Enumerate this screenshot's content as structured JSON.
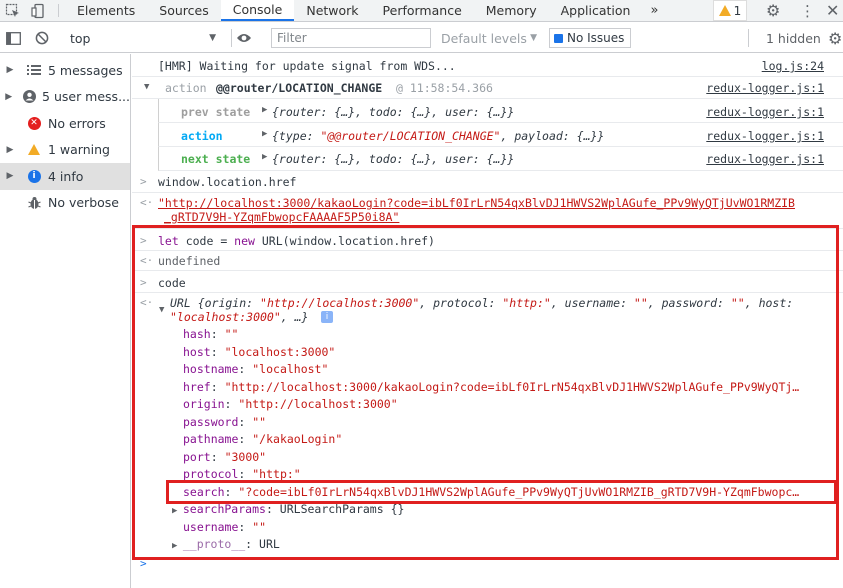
{
  "tabs": {
    "items": [
      "Elements",
      "Sources",
      "Console",
      "Network",
      "Performance",
      "Memory",
      "Application"
    ],
    "more": "»",
    "warning_count": "1"
  },
  "toolbar": {
    "context": "top",
    "filter_placeholder": "Filter",
    "levels": "Default levels",
    "issues": "No Issues",
    "hidden": "1 hidden"
  },
  "sidebar": {
    "items": [
      {
        "label": "5 messages",
        "icon": "list-icon"
      },
      {
        "label": "5 user mess...",
        "icon": "user-icon"
      },
      {
        "label": "No errors",
        "icon": "error-icon"
      },
      {
        "label": "1 warning",
        "icon": "warning-icon"
      },
      {
        "label": "4 info",
        "icon": "info-icon"
      },
      {
        "label": "No verbose",
        "icon": "bug-icon"
      }
    ]
  },
  "console": {
    "hmr": {
      "text": "[HMR] Waiting for update signal from WDS...",
      "source": "log.js:24"
    },
    "action_group": {
      "prefix": "action",
      "name": "@@router/LOCATION_CHANGE",
      "time": "@ 11:58:54.366",
      "source": "redux-logger.js:1"
    },
    "prev_state": {
      "label": "prev state",
      "value": "{router: {…}, todo: {…}, user: {…}}",
      "source": "redux-logger.js:1"
    },
    "action": {
      "label": "action",
      "value_pre": "{type: ",
      "value_str": "\"@@router/LOCATION_CHANGE\"",
      "value_post": ", payload: {…}}",
      "source": "redux-logger.js:1"
    },
    "next_state": {
      "label": "next state",
      "value": "{router: {…}, todo: {…}, user: {…}}",
      "source": "redux-logger.js:1"
    },
    "input1": "window.location.href",
    "result1_line1": "\"http://localhost:3000/kakaoLogin?code=ibLf0IrLrN54qxBlvDJ1HWVS2WplAGufe_PPv9WyQTjUvWO1RMZIB",
    "result1_line2": "_gRTD7V9H-YZqmFbwopcFAAAAF5P50i8A\"",
    "input2": {
      "kw1": "let",
      "var": " code = ",
      "kw2": "new",
      "rest": " URL(window.location.href)"
    },
    "result2": "undefined",
    "input3": "code",
    "url_obj": {
      "line1_pre": "URL {origin: ",
      "line1_origin": "\"http://localhost:3000\"",
      "line1_mid1": ", protocol: ",
      "line1_protocol": "\"http:\"",
      "line1_mid2": ", username: ",
      "line1_username": "\"\"",
      "line1_mid3": ", password: ",
      "line1_password": "\"\"",
      "line1_mid4": ", host: ",
      "line2_host": "\"localhost:3000\"",
      "line2_post": ", …}",
      "props": [
        {
          "key": "hash",
          "value": "\"\""
        },
        {
          "key": "host",
          "value": "\"localhost:3000\""
        },
        {
          "key": "hostname",
          "value": "\"localhost\""
        },
        {
          "key": "href",
          "value": "\"http://localhost:3000/kakaoLogin?code=ibLf0IrLrN54qxBlvDJ1HWVS2WplAGufe_PPv9WyQTj…"
        },
        {
          "key": "origin",
          "value": "\"http://localhost:3000\""
        },
        {
          "key": "password",
          "value": "\"\""
        },
        {
          "key": "pathname",
          "value": "\"/kakaoLogin\""
        },
        {
          "key": "port",
          "value": "\"3000\""
        },
        {
          "key": "protocol",
          "value": "\"http:\""
        },
        {
          "key": "search",
          "value": "\"?code=ibLf0IrLrN54qxBlvDJ1HWVS2WplAGufe_PPv9WyQTjUvWO1RMZIB_gRTD7V9H-YZqmFbwopc…"
        },
        {
          "key": "searchParams",
          "value": "URLSearchParams {}"
        },
        {
          "key": "username",
          "value": "\"\""
        },
        {
          "key": "__proto__",
          "value": "URL"
        }
      ]
    }
  },
  "colors": {
    "highlight": "#e02020",
    "accent": "#1a73e8",
    "string": "#c41a16",
    "property": "#881391"
  }
}
